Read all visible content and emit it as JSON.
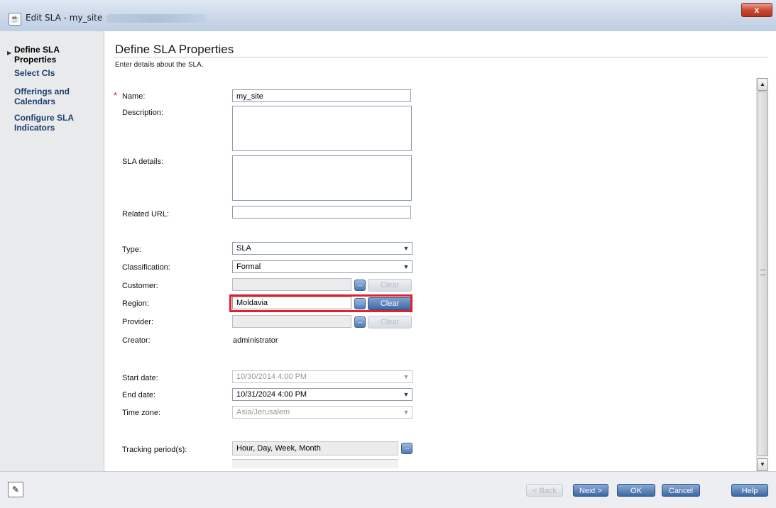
{
  "window": {
    "title": "Edit SLA - my_site",
    "close_label": "x"
  },
  "sidebar": {
    "items": [
      {
        "label_line1": "Define SLA",
        "label_line2": "Properties"
      },
      {
        "label_line1": "Select CIs",
        "label_line2": ""
      },
      {
        "label_line1": "Offerings and",
        "label_line2": "Calendars"
      },
      {
        "label_line1": "Configure SLA",
        "label_line2": "Indicators"
      }
    ]
  },
  "page": {
    "title": "Define SLA Properties",
    "subtitle": "Enter details about the SLA."
  },
  "form": {
    "required_marker": "*",
    "name_label": "Name:",
    "name_value": "my_site",
    "description_label": "Description:",
    "sla_details_label": "SLA details:",
    "related_url_label": "Related URL:",
    "type_label": "Type:",
    "type_value": "SLA",
    "classification_label": "Classification:",
    "classification_value": "Formal",
    "customer_label": "Customer:",
    "region_label": "Region:",
    "region_value": "Moldavia",
    "provider_label": "Provider:",
    "creator_label": "Creator:",
    "creator_value": "administrator",
    "start_date_label": "Start date:",
    "start_date_value": "10/30/2014 4:00 PM",
    "end_date_label": "End date:",
    "end_date_value": "10/31/2024 4:00 PM",
    "time_zone_label": "Time zone:",
    "time_zone_value": "Asia/Jerusalem",
    "tracking_label": "Tracking period(s):",
    "tracking_value": "Hour, Day, Week, Month",
    "clear_label": "Clear",
    "dots_label": "..."
  },
  "footer": {
    "back_label": "< Back",
    "next_label": "Next >",
    "ok_label": "OK",
    "cancel_label": "Cancel",
    "help_label": "Help"
  },
  "colors": {
    "highlight": "#e0202e",
    "accent": "#3c67a3"
  }
}
